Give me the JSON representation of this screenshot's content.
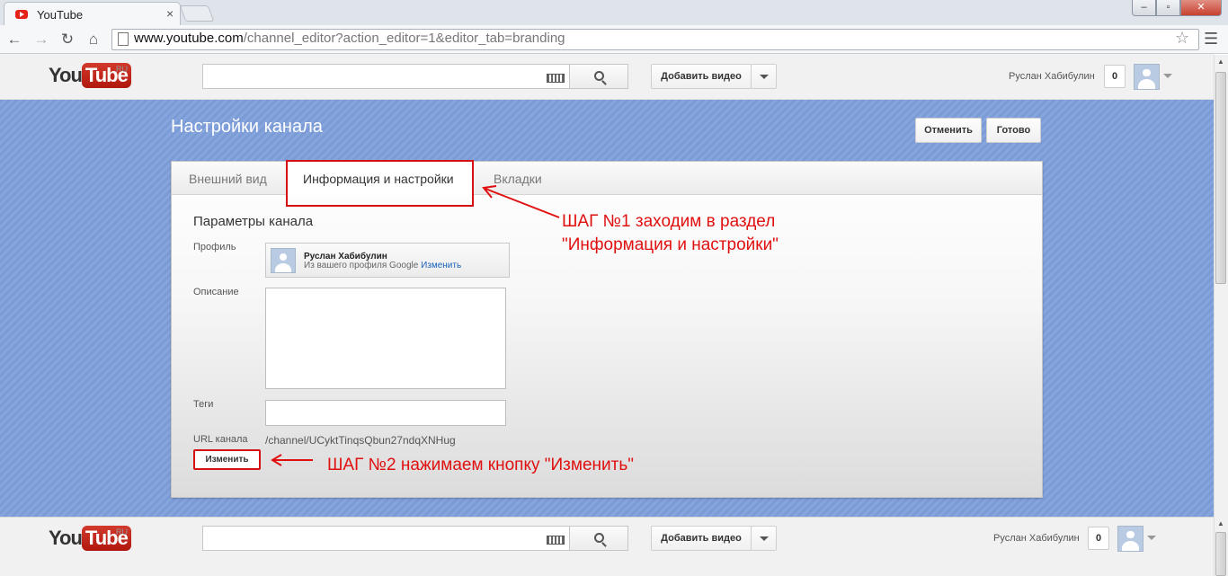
{
  "browser": {
    "tab_title": "YouTube",
    "url_host": "www.youtube.com",
    "url_path": "/channel_editor?action_editor=1&editor_tab=branding",
    "window_buttons": {
      "minimize": "–",
      "maximize": "▫",
      "close": "✕"
    },
    "tab_close": "×"
  },
  "header": {
    "logo_you": "You",
    "logo_tube": "Tube",
    "logo_region": "RU",
    "search_value": "",
    "upload_label": "Добавить видео",
    "user_name": "Руслан Хабибулин",
    "notifications": "0"
  },
  "editor": {
    "page_title": "Настройки канала",
    "cancel_label": "Отменить",
    "done_label": "Готово",
    "tabs": [
      {
        "label": "Внешний вид"
      },
      {
        "label": "Информация и настройки"
      },
      {
        "label": "Вкладки"
      }
    ],
    "active_tab": 1,
    "section_title": "Параметры канала",
    "profile_label": "Профиль",
    "profile_name": "Руслан Хабибулин",
    "profile_sub": "Из вашего профиля Google",
    "profile_change": "Изменить",
    "description_label": "Описание",
    "description_value": "",
    "tags_label": "Теги",
    "tags_value": "",
    "url_label": "URL канала",
    "url_value": "/channel/UCyktTinqsQbun27ndqXNHug",
    "change_button": "Изменить"
  },
  "annotations": {
    "step1_line1": "ШАГ №1 заходим в раздел",
    "step1_line2": "\"Информация и настройки\"",
    "step2": "ШАГ №2 нажимаем кнопку \"Изменить\"",
    "color": "#e01010"
  },
  "footer_header": {
    "logo_you": "You",
    "logo_tube": "Tube",
    "logo_region": "RU",
    "upload_label": "Добавить видео",
    "user_name": "Руслан Хабибулин",
    "notifications": "0"
  },
  "colors": {
    "band": "#7b9bd6",
    "brand_red": "#cc181e",
    "link": "#1c62b9"
  }
}
